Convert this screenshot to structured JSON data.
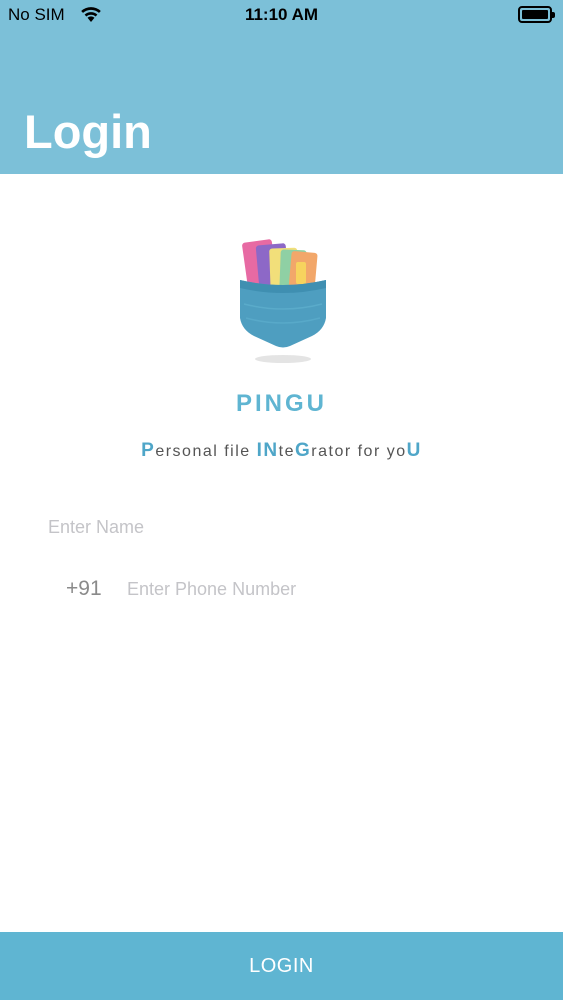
{
  "status_bar": {
    "carrier": "No SIM",
    "time": "11:10 AM",
    "wifi_icon": "wifi-icon",
    "battery_icon": "battery-full-icon"
  },
  "header": {
    "title": "Login",
    "background_color": "#7cc0d8"
  },
  "brand": {
    "logo_icon": "pingu-folder-logo-icon",
    "name": "PINGU",
    "tagline_parts": [
      {
        "text": "P",
        "highlight": true
      },
      {
        "text": "ersonal file ",
        "highlight": false
      },
      {
        "text": "IN",
        "highlight": true
      },
      {
        "text": "te",
        "highlight": false
      },
      {
        "text": "G",
        "highlight": true
      },
      {
        "text": "rator for yo",
        "highlight": false
      },
      {
        "text": "U",
        "highlight": true
      }
    ],
    "accent_color": "#5fb5d2"
  },
  "form": {
    "name": {
      "value": "",
      "placeholder": "Enter Name"
    },
    "country_code": "+91",
    "phone": {
      "value": "",
      "placeholder": "Enter Phone Number"
    }
  },
  "login_button": {
    "label": "LOGIN",
    "background_color": "#5fb5d2"
  }
}
